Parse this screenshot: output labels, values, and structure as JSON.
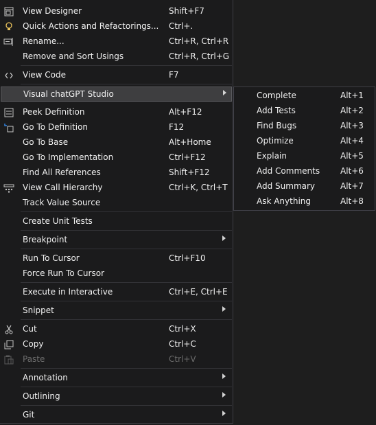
{
  "menu": {
    "items": [
      {
        "label": "View Designer",
        "shortcut": "Shift+F7",
        "icon": "view-designer-icon"
      },
      {
        "label": "Quick Actions and Refactorings...",
        "shortcut": "Ctrl+.",
        "icon": "lightbulb-icon"
      },
      {
        "label": "Rename...",
        "shortcut": "Ctrl+R, Ctrl+R",
        "icon": "rename-icon"
      },
      {
        "label": "Remove and Sort Usings",
        "shortcut": "Ctrl+R, Ctrl+G"
      },
      {
        "label": "View Code",
        "shortcut": "F7",
        "icon": "code-icon"
      },
      {
        "label": "Visual chatGPT Studio",
        "submenu": true
      },
      {
        "label": "Peek Definition",
        "shortcut": "Alt+F12",
        "icon": "peek-definition-icon"
      },
      {
        "label": "Go To Definition",
        "shortcut": "F12",
        "icon": "go-to-definition-icon"
      },
      {
        "label": "Go To Base",
        "shortcut": "Alt+Home"
      },
      {
        "label": "Go To Implementation",
        "shortcut": "Ctrl+F12"
      },
      {
        "label": "Find All References",
        "shortcut": "Shift+F12"
      },
      {
        "label": "View Call Hierarchy",
        "shortcut": "Ctrl+K, Ctrl+T",
        "icon": "call-hierarchy-icon"
      },
      {
        "label": "Track Value Source"
      },
      {
        "label": "Create Unit Tests"
      },
      {
        "label": "Breakpoint",
        "submenu": true
      },
      {
        "label": "Run To Cursor",
        "shortcut": "Ctrl+F10"
      },
      {
        "label": "Force Run To Cursor"
      },
      {
        "label": "Execute in Interactive",
        "shortcut": "Ctrl+E, Ctrl+E"
      },
      {
        "label": "Snippet",
        "submenu": true
      },
      {
        "label": "Cut",
        "shortcut": "Ctrl+X",
        "icon": "scissors-icon"
      },
      {
        "label": "Copy",
        "shortcut": "Ctrl+C",
        "icon": "copy-icon"
      },
      {
        "label": "Paste",
        "shortcut": "Ctrl+V",
        "icon": "paste-icon",
        "disabled": true
      },
      {
        "label": "Annotation",
        "submenu": true
      },
      {
        "label": "Outlining",
        "submenu": true
      },
      {
        "label": "Git",
        "submenu": true
      }
    ]
  },
  "submenu": {
    "title": "Visual chatGPT Studio",
    "items": [
      {
        "label": "Complete",
        "shortcut": "Alt+1"
      },
      {
        "label": "Add Tests",
        "shortcut": "Alt+2"
      },
      {
        "label": "Find Bugs",
        "shortcut": "Alt+3"
      },
      {
        "label": "Optimize",
        "shortcut": "Alt+4"
      },
      {
        "label": "Explain",
        "shortcut": "Alt+5"
      },
      {
        "label": "Add Comments",
        "shortcut": "Alt+6"
      },
      {
        "label": "Add Summary",
        "shortcut": "Alt+7"
      },
      {
        "label": "Ask Anything",
        "shortcut": "Alt+8"
      }
    ]
  }
}
